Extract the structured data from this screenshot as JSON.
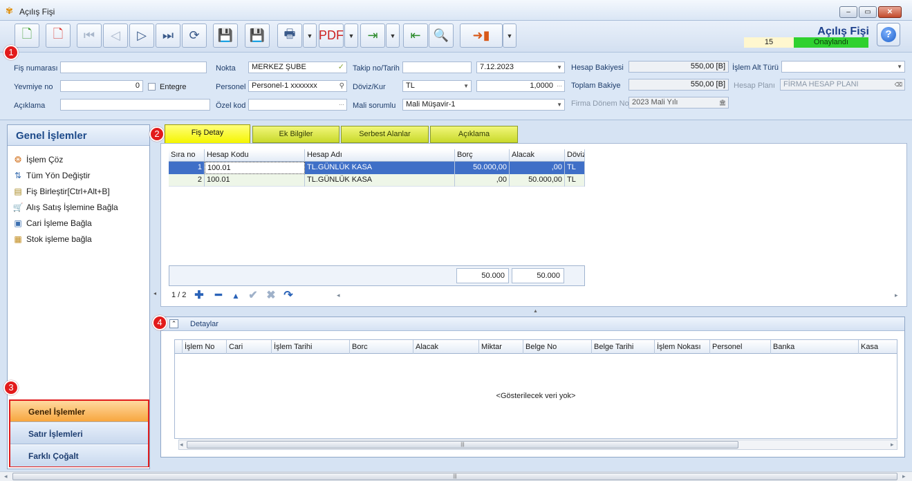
{
  "window": {
    "title": "Açılış Fişi"
  },
  "header": {
    "title": "Açılış Fişi",
    "number": "15",
    "status": "Onaylandı",
    "status_color": "#2fd12f"
  },
  "toolbar": {
    "buttons": [
      "new-document",
      "delete-document",
      "first",
      "previous",
      "next",
      "last",
      "refresh",
      "save",
      "save-close",
      "print",
      "pdf",
      "export",
      "import",
      "settings",
      "exit"
    ]
  },
  "form": {
    "fis_numarasi": {
      "label": "Fiş numarası",
      "value": ""
    },
    "yevmiye_no": {
      "label": "Yevmiye no",
      "value": "0"
    },
    "entegre": {
      "label": "Entegre"
    },
    "aciklama": {
      "label": "Açıklama",
      "value": ""
    },
    "nokta": {
      "label": "Nokta",
      "value": "MERKEZ ŞUBE"
    },
    "personel": {
      "label": "Personel",
      "value": "Personel-1 xxxxxxx"
    },
    "ozel_kod": {
      "label": "Özel kod",
      "value": ""
    },
    "takip_no": {
      "label": "Takip no/Tarih",
      "value": "",
      "date": "7.12.2023"
    },
    "doviz_kur": {
      "label": "Döviz/Kur",
      "currency": "TL",
      "rate": "1,0000"
    },
    "mali_sorumlu": {
      "label": "Mali sorumlu",
      "value": "Mali Müşavir-1"
    },
    "hesap_bakiyesi": {
      "label": "Hesap Bakiyesi",
      "value": "550,00 [B]"
    },
    "toplam_bakiye": {
      "label": "Toplam Bakiye",
      "value": "550,00 [B]"
    },
    "firma_donem": {
      "label": "Firma Dönem No",
      "value": "2023 Mali Yılı"
    },
    "islem_alt_turu": {
      "label": "İşlem Alt Türü",
      "value": ""
    },
    "hesap_plani": {
      "label": "Hesap Planı",
      "value": "FİRMA HESAP PLANI"
    }
  },
  "badges": [
    "1",
    "2",
    "3",
    "4"
  ],
  "left_panel": {
    "title": "Genel İşlemler",
    "items": [
      {
        "label": "İşlem Çöz",
        "icon": "link-icon"
      },
      {
        "label": "Tüm Yön Değiştir",
        "icon": "swap-icon"
      },
      {
        "label": "Fiş Birleştir[Ctrl+Alt+B]",
        "icon": "merge-icon"
      },
      {
        "label": "Alış Satış İşlemine Bağla",
        "icon": "cart-icon"
      },
      {
        "label": "Cari İşleme Bağla",
        "icon": "card-icon"
      },
      {
        "label": "Stok işleme bağla",
        "icon": "stock-icon"
      }
    ],
    "nav_buttons": [
      "Genel İşlemler",
      "Satır İşlemleri",
      "Farklı Çoğalt"
    ]
  },
  "tabs": [
    "Fiş Detay",
    "Ek Bilgiler",
    "Serbest Alanlar",
    "Açıklama"
  ],
  "grid": {
    "columns": [
      "Sıra no",
      "Hesap Kodu",
      "Hesap Adı",
      "Borç",
      "Alacak",
      "Döviz"
    ],
    "rows": [
      [
        "1",
        "100.01",
        "TL.GÜNLÜK KASA",
        "50.000,00",
        ",00",
        "TL"
      ],
      [
        "2",
        "100.01",
        "TL.GÜNLÜK KASA",
        ",00",
        "50.000,00",
        "TL"
      ]
    ],
    "totals": {
      "borc": "50.000",
      "alacak": "50.000"
    },
    "pager": "1 / 2"
  },
  "details": {
    "title": "Detaylar",
    "columns": [
      "İşlem No",
      "Cari",
      "İşlem Tarihi",
      "Borc",
      "Alacak",
      "Miktar",
      "Belge No",
      "Belge Tarihi",
      "İşlem Nokası",
      "Personel",
      "Banka",
      "Kasa"
    ],
    "empty_text": "<Gösterilecek veri yok>"
  }
}
